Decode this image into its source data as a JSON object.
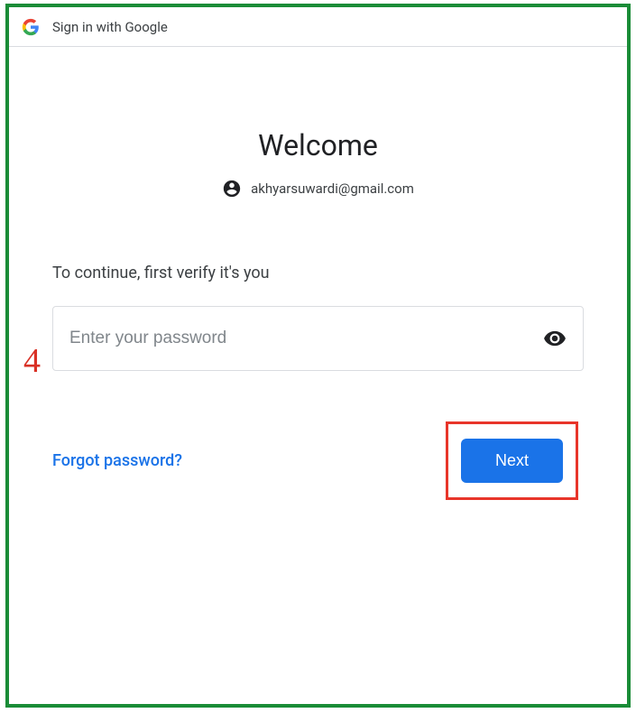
{
  "header": {
    "title": "Sign in with Google"
  },
  "main": {
    "welcome": "Welcome",
    "email": "akhyarsuwardi@gmail.com",
    "verify_prompt": "To continue, first verify it's you",
    "password_placeholder": "Enter your password",
    "forgot_label": "Forgot password?",
    "next_label": "Next"
  },
  "annotation": {
    "step_number": "4"
  },
  "colors": {
    "frame_border": "#1a8c37",
    "highlight_border": "#e8352a",
    "primary_button": "#1a73e8",
    "link": "#1a73e8"
  }
}
